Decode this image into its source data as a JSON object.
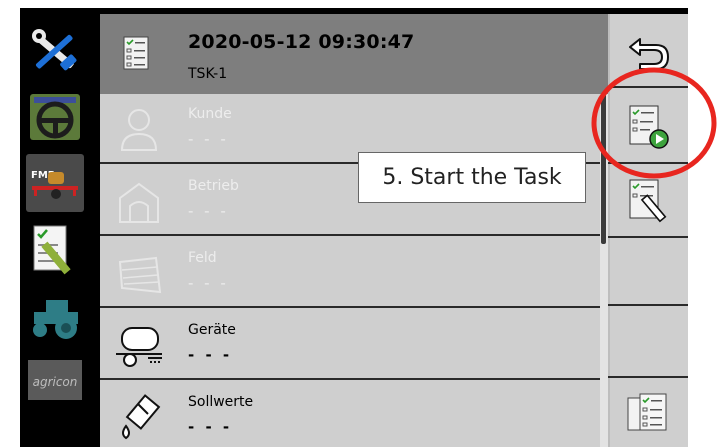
{
  "header": {
    "title": "2020-05-12 09:30:47",
    "subtitle": "TSK-1",
    "icon": "task-list-icon"
  },
  "fields": [
    {
      "label": "Kunde",
      "value": "- - -",
      "enabled": false,
      "icon": "customer-person-icon"
    },
    {
      "label": "Betrieb",
      "value": "- - -",
      "enabled": false,
      "icon": "farm-barn-icon"
    },
    {
      "label": "Feld",
      "value": "- - -",
      "enabled": false,
      "icon": "field-parcel-icon"
    },
    {
      "label": "Geräte",
      "value": "- - -",
      "enabled": true,
      "icon": "implement-tank-icon"
    },
    {
      "label": "Sollwerte",
      "value": "- - -",
      "enabled": true,
      "icon": "setpoint-drop-icon"
    }
  ],
  "left_apps": [
    {
      "icon": "settings-tools-icon",
      "active": false
    },
    {
      "icon": "steering-wheel-icon",
      "active": false
    },
    {
      "icon": "sprayer-fmr-icon",
      "active": true,
      "text": "FMR"
    },
    {
      "icon": "task-controller-icon",
      "active": false
    },
    {
      "icon": "tractor-icon",
      "active": false
    },
    {
      "icon": "agricon-logo-icon",
      "active": false,
      "text": "agricon"
    }
  ],
  "softkeys": [
    {
      "icon": "back-arrow-icon"
    },
    {
      "icon": "start-task-icon"
    },
    {
      "icon": "edit-task-icon"
    },
    {
      "icon": "task-list-overview-icon"
    }
  ],
  "callout": {
    "text": "5. Start the Task"
  },
  "colors": {
    "annotation_ring": "#e8261f",
    "header_bg": "#7e7e7e",
    "panel_bg": "#cfcfcf"
  }
}
